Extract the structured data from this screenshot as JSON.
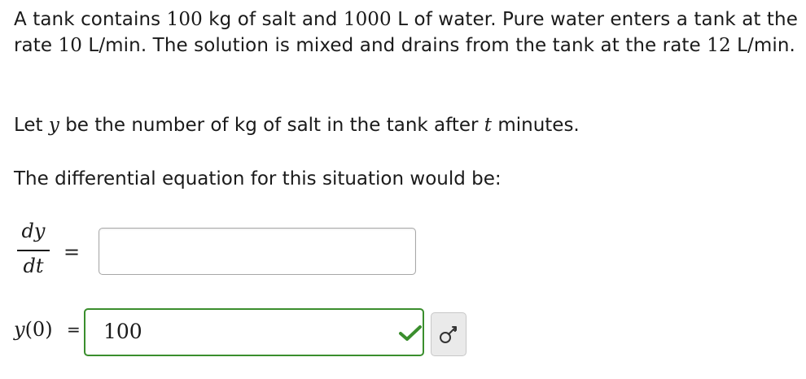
{
  "problem": {
    "part1": "A tank contains ",
    "salt_amount": "100",
    "part2": " kg of salt and ",
    "water_amount": "1000",
    "part3": " L of water. Pure water enters a tank at the rate ",
    "rate_in": "10",
    "part4": " L/min. The solution is mixed and drains from the tank at the rate ",
    "rate_out": "12",
    "part5": " L/min.",
    "let_prefix": "Let ",
    "let_var_y": "y",
    "let_mid": " be the number of kg of salt in the tank after ",
    "let_var_t": "t",
    "let_suffix": " minutes.",
    "de_prompt": "The differential equation for this situation would be:"
  },
  "derivative": {
    "numerator": "dy",
    "denominator": "dt",
    "equals": "="
  },
  "answer1": {
    "value": ""
  },
  "initial": {
    "label_y": "y",
    "label_arg": "(0)",
    "equals": "=",
    "value": "100",
    "status": "correct",
    "status_icon": "checkmark-icon",
    "status_color": "#3a8e2d"
  },
  "preview_button": {
    "icon": "key-icon"
  }
}
